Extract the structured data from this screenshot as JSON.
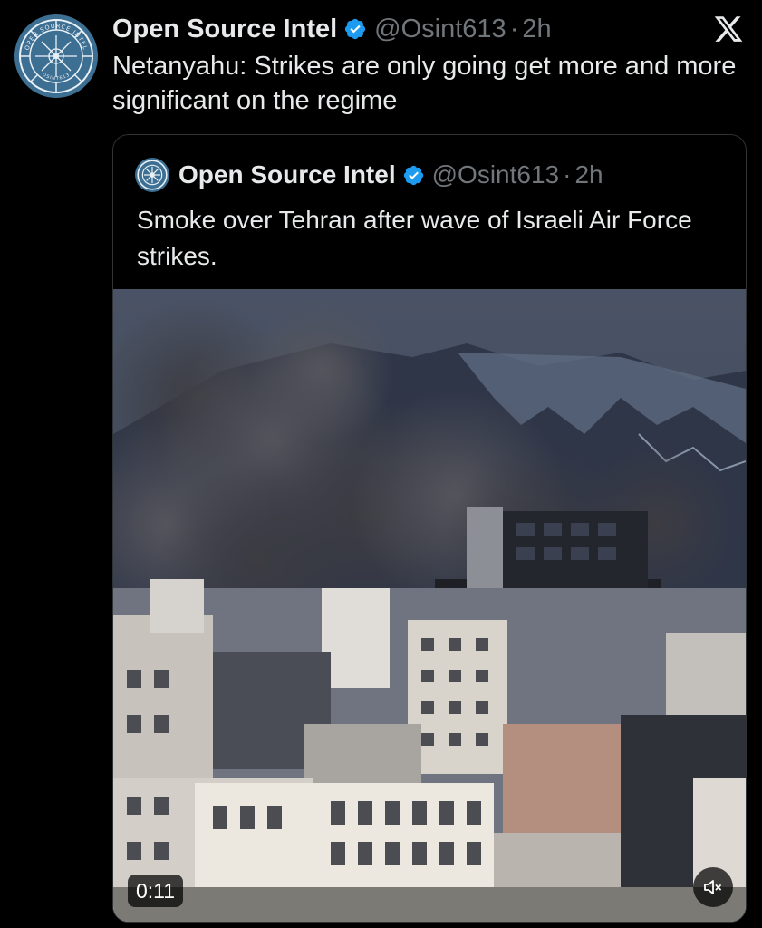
{
  "tweet": {
    "author_name": "Open Source Intel",
    "handle": "@Osint613",
    "separator": "·",
    "time": "2h",
    "text": "Netanyahu: Strikes are only going get more and more significant on the regime",
    "avatar_ring_text": "OPEN SOURCE INTEL",
    "avatar_bottom_text": "OSINT613"
  },
  "quoted_tweet": {
    "author_name": "Open Source Intel",
    "handle": "@Osint613",
    "separator": "·",
    "time": "2h",
    "text": "Smoke over Tehran after wave of Israeli Air Force strikes.",
    "media": {
      "type": "video",
      "duration": "0:11",
      "muted": true
    }
  },
  "icons": {
    "verified": "verified-badge-icon",
    "platform": "x-logo-icon",
    "mute": "speaker-muted-icon"
  },
  "colors": {
    "background": "#000000",
    "text_primary": "#e7e9ea",
    "text_secondary": "#71767b",
    "verified_blue": "#1d9bf0",
    "border": "#2f3336",
    "avatar_blue": "#3d6f93"
  }
}
